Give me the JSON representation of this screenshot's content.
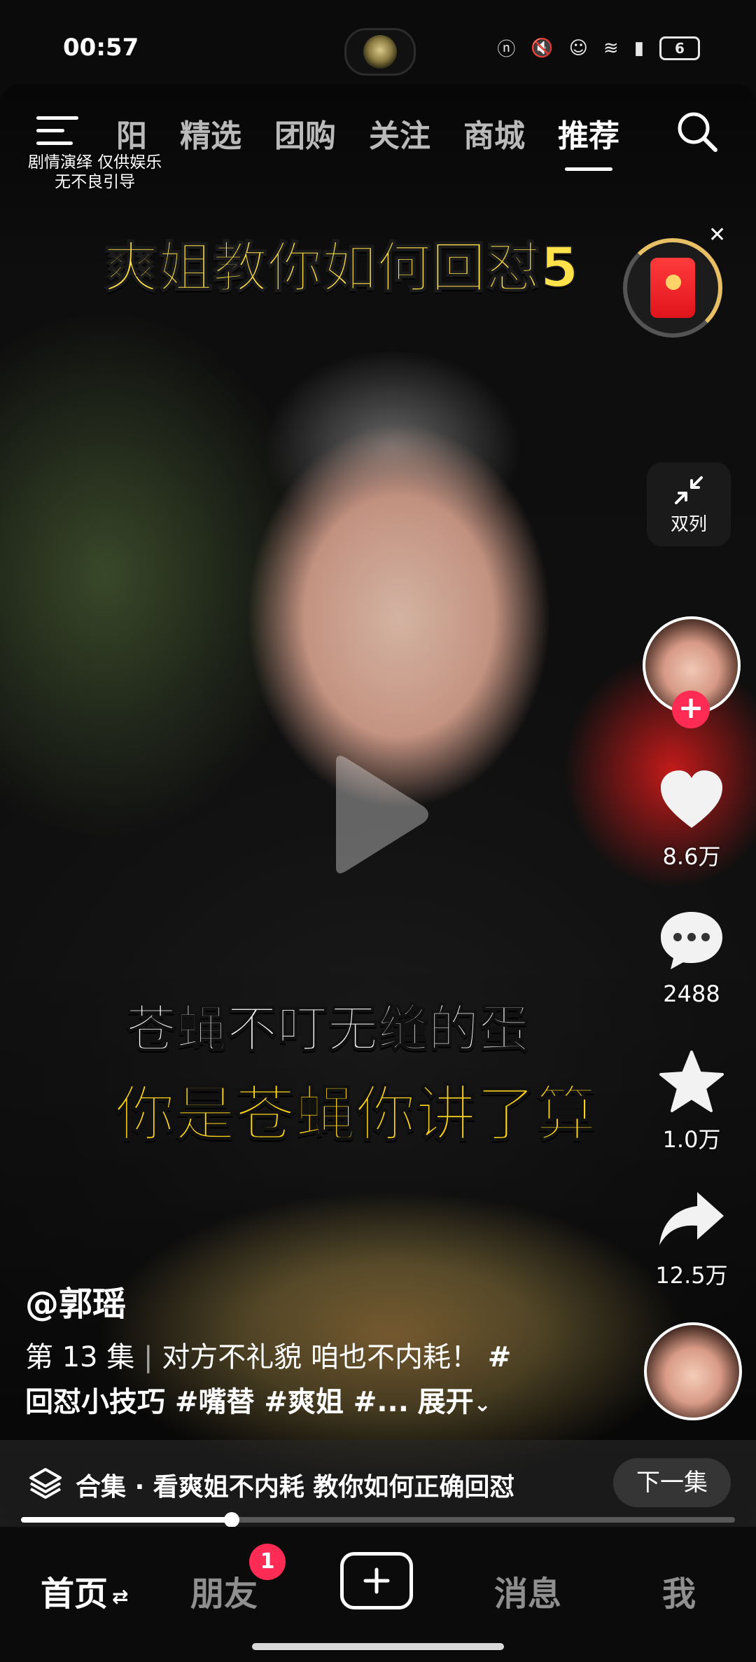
{
  "status_bar": {
    "time": "00:57",
    "icons": [
      "nfc-icon",
      "mute-icon",
      "status-cat-icon",
      "status-cat-icon",
      "wifi-icon",
      "signal-icon"
    ],
    "battery": "6"
  },
  "top_nav": {
    "tabs": [
      "阳",
      "精选",
      "团购",
      "关注",
      "商城",
      "推荐"
    ],
    "active_tab": "推荐"
  },
  "disclaimer": {
    "line1": "剧情演绎 仅供娱乐",
    "line2": "无不良引导"
  },
  "video": {
    "title_overlay": "爽姐教你如何回怼5",
    "subtitle_line1": "苍蝇不叮无缝的蛋",
    "subtitle_line2": "你是苍蝇你讲了算",
    "dual_column_label": "双列"
  },
  "right_rail": {
    "likes": "8.6万",
    "comments": "2488",
    "favorites": "1.0万",
    "shares": "12.5万"
  },
  "post": {
    "author": "@郭瑶",
    "episode": "第 13 集",
    "description": "对方不礼貌 咱也不内耗！",
    "hashtag_lead": "#",
    "tags_line": "回怼小技巧 #嘴替 #爽姐 #...",
    "expand_label": "展开"
  },
  "collection": {
    "label": "合集",
    "separator": "·",
    "title": "看爽姐不内耗 教你如何正确回怼",
    "next_button": "下一集"
  },
  "progress": {
    "fraction": 0.295
  },
  "bottom_nav": {
    "home": "首页",
    "friends": "朋友",
    "friends_badge": "1",
    "messages": "消息",
    "me": "我"
  },
  "colors": {
    "accent": "#fe2c55",
    "subtitle_yellow": "#ffd71a",
    "title_yellow": "#ffe24a"
  }
}
